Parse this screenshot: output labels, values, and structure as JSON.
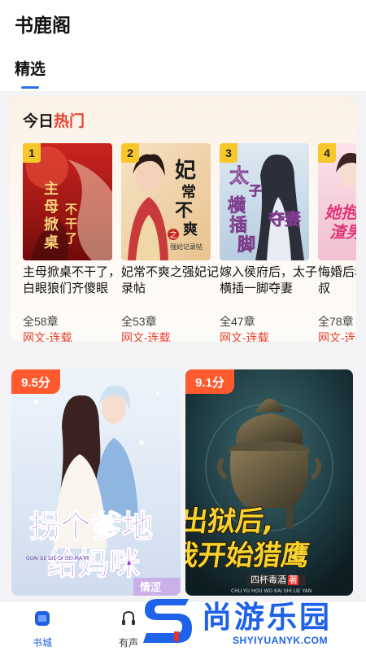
{
  "app": {
    "title": "书鹿阁"
  },
  "tabs": [
    {
      "label": "精选",
      "active": true
    }
  ],
  "hot_section": {
    "title_black": "今日",
    "title_red": "热门",
    "books": [
      {
        "rank": "1",
        "name": "主母掀桌不干了，白眼狼们齐傻眼",
        "chapters": "全58章",
        "genre": "网文-连载",
        "cover_text": "主母掀桌不干了"
      },
      {
        "rank": "2",
        "name": "妃常不爽之强妃记录帖",
        "chapters": "全53章",
        "genre": "网文-连载",
        "cover_text": "妃常不爽"
      },
      {
        "rank": "3",
        "name": "嫁入侯府后，太子横插一脚夺妻",
        "chapters": "全47章",
        "genre": "网文-连载",
        "cover_text": "太子横插一脚"
      },
      {
        "rank": "4",
        "name": "悔婚后着孕肚男小叔",
        "chapters": "全78章",
        "genre": "网文-连载",
        "cover_text": "她抱渣男"
      }
    ]
  },
  "featured": [
    {
      "score": "9.5分",
      "cover_text": "拐个爹地给妈咪",
      "cover_sub": "GUAI GE DIE DI GEI MA MI",
      "author": "情涩"
    },
    {
      "score": "9.1分",
      "cover_text_1": "出狱后，",
      "cover_text_2": "我开始猎鹰",
      "author": "四杯毒酒",
      "author_suffix": "著",
      "cover_sub": "CHU YU HOU WO KAI SHI LIE YAN"
    }
  ],
  "bottom_nav": [
    {
      "label": "书城",
      "icon": "bookstore-icon",
      "active": true
    },
    {
      "label": "有声",
      "icon": "audio-icon",
      "active": false
    }
  ],
  "watermark": {
    "text": "尚游乐园",
    "url": "SHYIYUANYK.COM"
  },
  "colors": {
    "accent": "#2f6ff0",
    "red": "#e5432f",
    "badge_yellow": "#f7c72c",
    "score_orange": "#ff5a2e",
    "watermark_blue": "#1d62e8"
  }
}
